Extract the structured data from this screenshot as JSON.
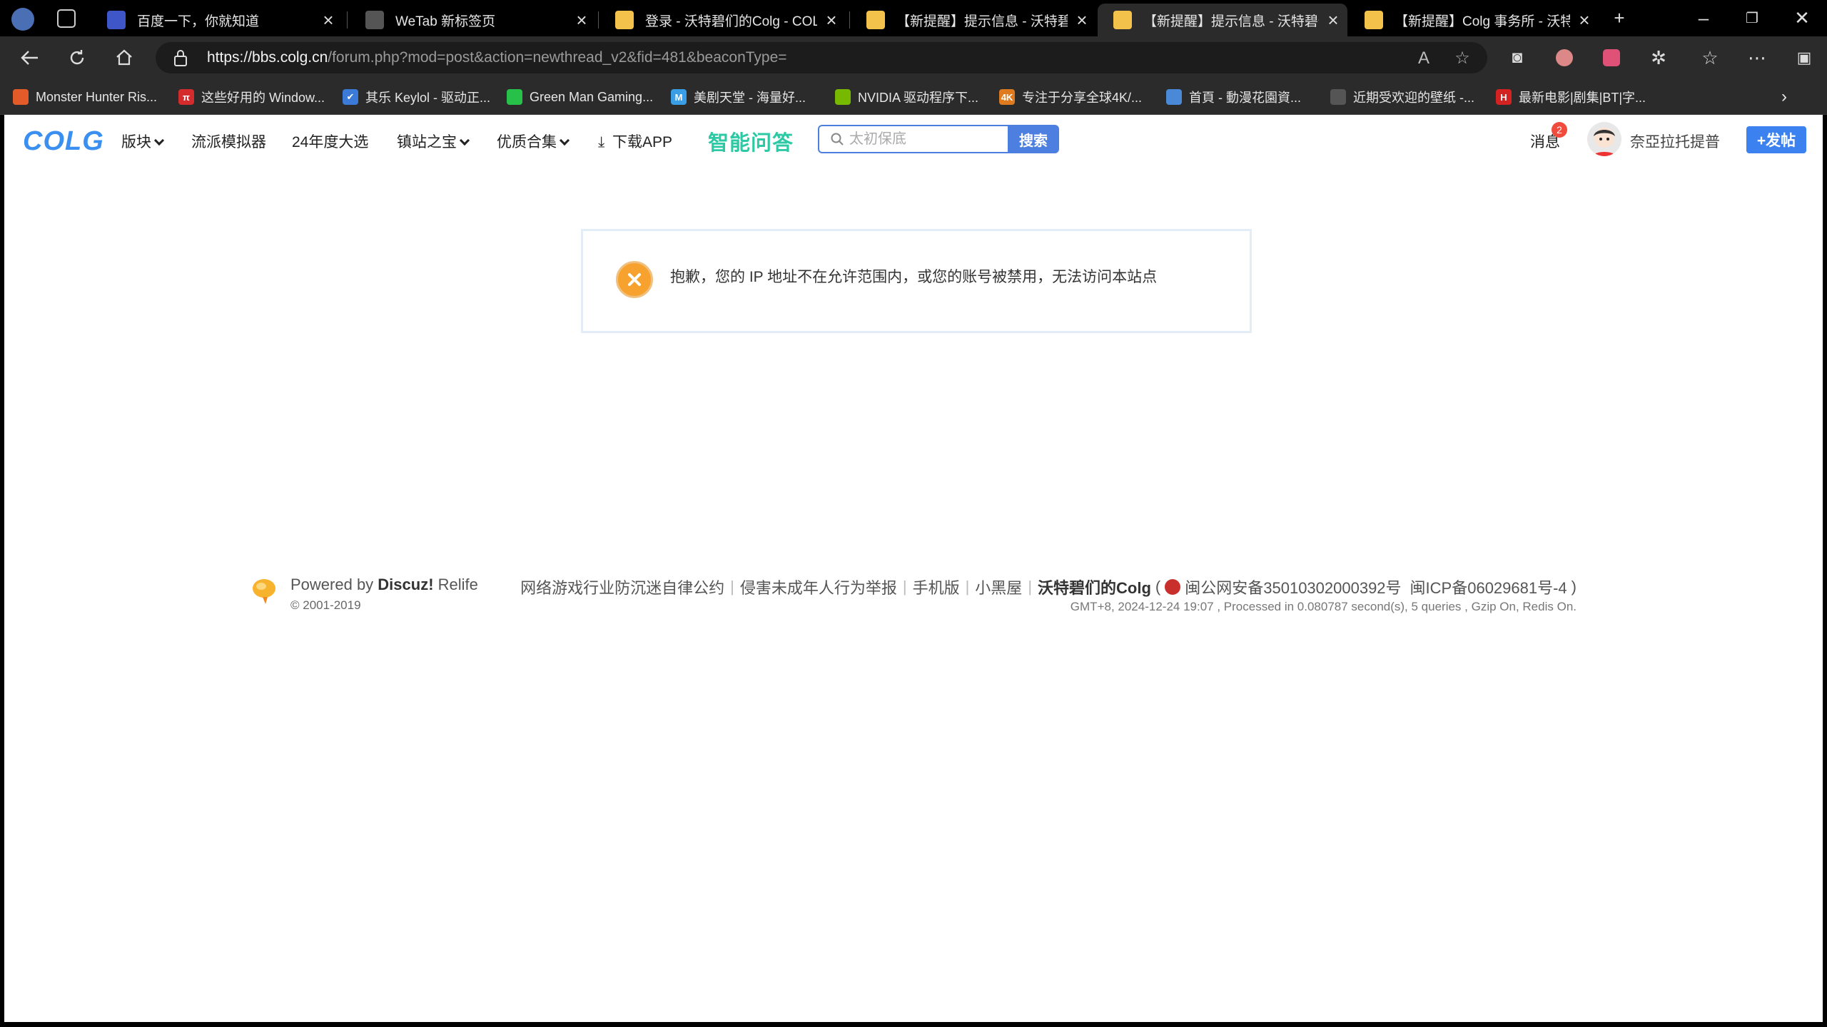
{
  "browser": {
    "tabs": [
      {
        "title": "百度一下，你就知道",
        "color": "#3f56c9"
      },
      {
        "title": "WeTab 新标签页",
        "color": "#555555"
      },
      {
        "title": "登录 - 沃特碧们的Colg - COLG玩",
        "color": "#f3c24a"
      },
      {
        "title": "【新提醒】提示信息 - 沃特碧们的",
        "color": "#f3c24a"
      },
      {
        "title": "【新提醒】提示信息 - 沃特碧们的",
        "color": "#f3c24a",
        "active": true
      },
      {
        "title": "【新提醒】Colg 事务所 - 沃特碧",
        "color": "#f3c24a"
      }
    ],
    "url_host": "https://bbs.colg.cn",
    "url_path": "/forum.php?mod=post&action=newthread_v2&fid=481&beaconType=",
    "bookmarks": [
      {
        "label": "Monster Hunter Ris...",
        "color": "#e45b2a",
        "glyph": ""
      },
      {
        "label": "这些好用的 Window...",
        "color": "#d42c2c",
        "glyph": "π"
      },
      {
        "label": "其乐 Keylol - 驱动正...",
        "color": "#3b7ad6",
        "glyph": "✔"
      },
      {
        "label": "Green Man Gaming...",
        "color": "#27c14a",
        "glyph": ""
      },
      {
        "label": "美剧天堂 - 海量好...",
        "color": "#3a9ee6",
        "glyph": "M"
      },
      {
        "label": "NVIDIA 驱动程序下...",
        "color": "#76b900",
        "glyph": ""
      },
      {
        "label": "专注于分享全球4K/...",
        "color": "#e07a1e",
        "glyph": "4K"
      },
      {
        "label": "首頁 - 動漫花園資...",
        "color": "#4a88d8",
        "glyph": ""
      },
      {
        "label": "近期受欢迎的壁纸 -...",
        "color": "#555555",
        "glyph": ""
      },
      {
        "label": "最新电影|剧集|BT|字...",
        "color": "#d32222",
        "glyph": "H"
      }
    ]
  },
  "site": {
    "logo": "COLG",
    "nav": [
      {
        "label": "版块",
        "dropdown": true
      },
      {
        "label": "流派模拟器",
        "dropdown": false
      },
      {
        "label": "24年度大选",
        "dropdown": false
      },
      {
        "label": "镇站之宝",
        "dropdown": true
      },
      {
        "label": "优质合集",
        "dropdown": true
      }
    ],
    "download_label": "下载APP",
    "ai_label": "智能问答",
    "search_placeholder": "太初保底",
    "search_button": "搜索",
    "messages_label": "消息",
    "messages_count": "2",
    "username": "奈亞拉托提普",
    "post_button": "+发帖"
  },
  "alert": {
    "message": "抱歉，您的 IP 地址不在允许范围内，或您的账号被禁用，无法访问本站点"
  },
  "footer": {
    "powered_prefix": "Powered by ",
    "powered_brand": "Discuz!",
    "powered_suffix": " Relife",
    "copyright": "© 2001-2019",
    "links": [
      "网络游戏行业防沉迷自律公约",
      "侵害未成年人行为举报",
      "手机版",
      "小黑屋"
    ],
    "site_name": "沃特碧们的Colg",
    "gongan": "闽公网安备35010302000392号",
    "icp": "闽ICP备06029681号-4",
    "stats": "GMT+8, 2024-12-24 19:07 , Processed in 0.080787 second(s), 5 queries , Gzip On, Redis On."
  }
}
